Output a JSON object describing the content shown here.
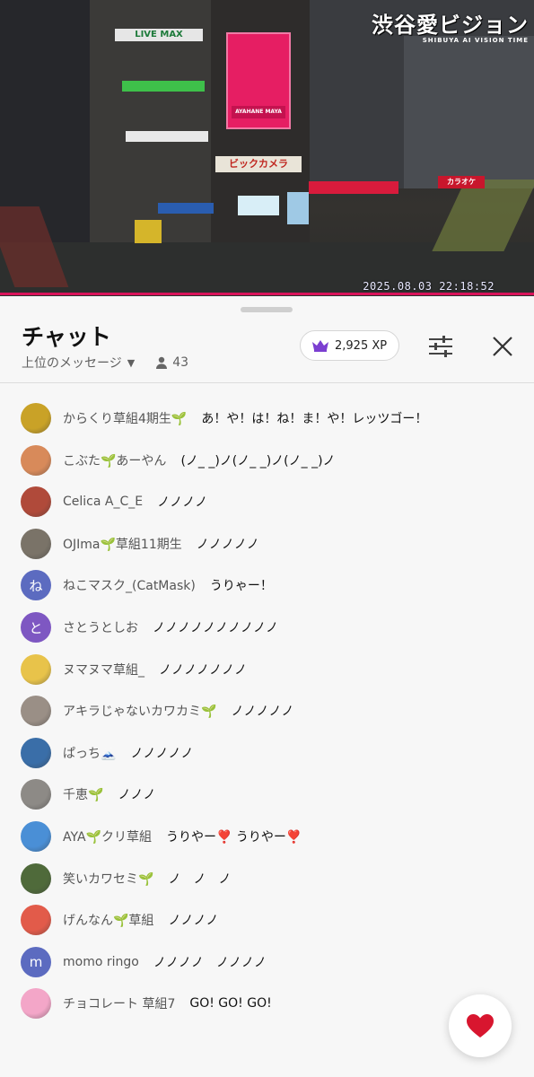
{
  "video": {
    "watermark_title": "渋谷愛ビジョン",
    "watermark_subtitle": "SHIBUYA AI VISION TIME",
    "timestamp": "2025.08.03 22:18:52",
    "signs": {
      "live_max": "LIVE MAX",
      "ayahane": "AYAHANE MAYA",
      "bic_camera": "ビックカメラ",
      "karaoke": "カラオケ"
    }
  },
  "chat": {
    "title": "チャット",
    "mode_label": "上位のメッセージ",
    "viewer_count": "43",
    "xp_label": "2,925 XP",
    "accent_color": "#7b3fd1",
    "like_color": "#d8162f",
    "messages": [
      {
        "author": "からくり草組4期生🌱",
        "text": "あ！や！は！ね！ま！や！レッツゴー！",
        "avatar": "duck-avatar",
        "color": "#c9a227"
      },
      {
        "author": "こぶた🌱あーやん",
        "text": "(ノ_ _)ノ(ノ_ _)ノ(ノ_ _)ノ",
        "avatar": "monkey-avatar",
        "color": "#d88a5a"
      },
      {
        "author": "Celica A_C_E",
        "text": "ノノノノ",
        "avatar": "bird-avatar",
        "color": "#b04a3a"
      },
      {
        "author": "OJIma🌱草組11期生",
        "text": "ノノノノノ",
        "avatar": "cat-avatar",
        "color": "#7a7368"
      },
      {
        "author": "ねこマスク_(CatMask)",
        "text": "うりゃー！",
        "letter": "ね",
        "color": "#5c6bc0"
      },
      {
        "author": "さとうとしお",
        "text": "ノノノノノノノノノノ",
        "letter": "と",
        "color": "#7e57c2"
      },
      {
        "author": "ヌマヌマ草組_",
        "text": "ノノノノノノノ",
        "avatar": "sticker-avatar",
        "color": "#e8c34a"
      },
      {
        "author": "アキラじゃないカワカミ🌱",
        "text": "ノノノノノ",
        "avatar": "photo-avatar",
        "color": "#9a8f86"
      },
      {
        "author": "ぱっち🗻",
        "text": "ノノノノノ",
        "avatar": "torii-avatar",
        "color": "#3a6ea8"
      },
      {
        "author": "千恵🌱",
        "text": "ノノノ",
        "avatar": "cup-avatar",
        "color": "#8d8a86"
      },
      {
        "author": "AYA🌱クリ草組",
        "text": "うりやー❣️ うりやー❣️",
        "avatar": "fuji-avatar",
        "color": "#4a8fd6"
      },
      {
        "author": "笑いカワセミ🌱",
        "text": "ノ　ノ　ノ",
        "avatar": "kingfisher-avatar",
        "color": "#4f6a3a"
      },
      {
        "author": "げんなん🌱草組",
        "text": "ノノノノ",
        "avatar": "onsen-avatar",
        "color": "#e25b4a"
      },
      {
        "author": "momo ringo",
        "text": "ノノノノ　ノノノノ",
        "letter": "m",
        "color": "#5c6bc0"
      },
      {
        "author": "チョコレート 草組7",
        "text": "GO! GO! GO!",
        "avatar": "bunny-avatar",
        "color": "#f3a6c8"
      }
    ]
  }
}
